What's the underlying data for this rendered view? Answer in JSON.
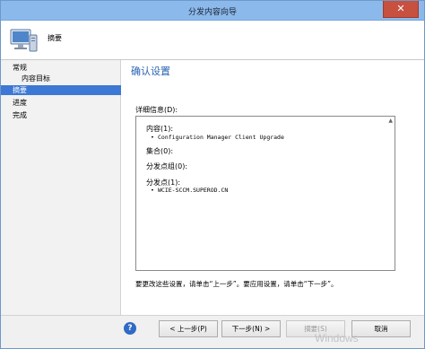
{
  "window": {
    "title": "分发内容向导",
    "close_glyph": "✕"
  },
  "header": {
    "step_title": "摘要",
    "icon": "computer-icon"
  },
  "nav": {
    "items": [
      {
        "label": "常规",
        "sub": false,
        "active": false
      },
      {
        "label": "内容目标",
        "sub": true,
        "active": false
      },
      {
        "label": "摘要",
        "sub": false,
        "active": true
      },
      {
        "label": "进度",
        "sub": false,
        "active": false
      },
      {
        "label": "完成",
        "sub": false,
        "active": false
      }
    ]
  },
  "content": {
    "page_title": "确认设置",
    "details_label": "详细信息(D):",
    "details": {
      "content_head": "内容(1):",
      "content_item": "Configuration Manager Client Upgrade",
      "collection_head": "集合(0):",
      "dp_group_head": "分发点组(0):",
      "dp_head": "分发点(1):",
      "dp_item": "WCIE-SCCM.SUPEROD.CN"
    },
    "hint": "要更改这些设置，请单击“上一步”。要应用设置，请单击“下一步”。"
  },
  "footer": {
    "help_glyph": "?",
    "prev_label": "< 上一步(P)",
    "next_label": "下一步(N) >",
    "summary_label": "摘要(S)",
    "cancel_label": "取消"
  },
  "watermark": "Windows",
  "colors": {
    "titlebar": "#8bb9ec",
    "accent": "#2a63b3",
    "nav_active": "#3d78d4",
    "close": "#c7503f"
  }
}
